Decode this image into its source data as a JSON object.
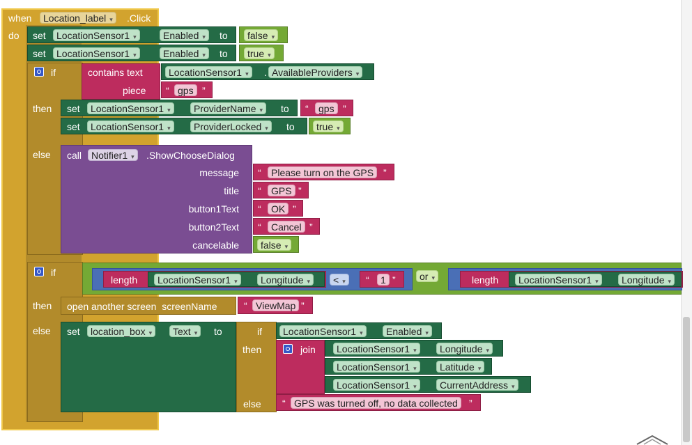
{
  "event": {
    "when": "when",
    "component": "Location_label",
    "event": ".Click",
    "do": "do"
  },
  "set1": {
    "set": "set",
    "comp": "LocationSensor1",
    "prop": "Enabled",
    "to": "to",
    "value": "false"
  },
  "set2": {
    "set": "set",
    "comp": "LocationSensor1",
    "prop": "Enabled",
    "to": "to",
    "value": "true"
  },
  "if1": {
    "if": "if",
    "contains": "contains text",
    "comp": "LocationSensor1",
    "prop": "AvailableProviders",
    "piece": "piece",
    "text": "gps",
    "then": "then",
    "else": "else"
  },
  "then1": {
    "set": "set",
    "comp": "LocationSensor1",
    "prop": "ProviderName",
    "to": "to",
    "value": "gps"
  },
  "then2": {
    "set": "set",
    "comp": "LocationSensor1",
    "prop": "ProviderLocked",
    "to": "to",
    "value": "true"
  },
  "call": {
    "call": "call",
    "comp": "Notifier1",
    "method": ".ShowChooseDialog",
    "args": [
      {
        "label": "message",
        "value": "Please turn on the GPS"
      },
      {
        "label": "title",
        "value": "GPS"
      },
      {
        "label": "button1Text",
        "value": "OK"
      },
      {
        "label": "button2Text",
        "value": "Cancel"
      }
    ],
    "cancel_label": "cancelable",
    "cancel_value": "false"
  },
  "if2": {
    "if": "if",
    "length": "length",
    "comp": "LocationSensor1",
    "prop": "Longitude",
    "op": "<",
    "num": "1",
    "or": "or",
    "length2": "length",
    "comp2": "LocationSensor1",
    "prop2": "Longitude",
    "then": "then",
    "else": "else"
  },
  "open": {
    "label": "open another screen  screenName",
    "value": "ViewMap"
  },
  "setbox": {
    "set": "set",
    "comp": "location_box",
    "prop": "Text",
    "to": "to"
  },
  "inlineif": {
    "if": "if",
    "comp": "LocationSensor1",
    "prop": "Enabled",
    "then": "then",
    "else": "else"
  },
  "join": {
    "label": "join",
    "rows": [
      {
        "comp": "LocationSensor1",
        "prop": "Longitude"
      },
      {
        "comp": "LocationSensor1",
        "prop": "Latitude"
      },
      {
        "comp": "LocationSensor1",
        "prop": "CurrentAddress"
      }
    ]
  },
  "elsemsg": "GPS was turned off, no data collected",
  "quote_open": "“",
  "quote_close": "”",
  "icons": {
    "mutator": "gear-icon",
    "dropdown": "chevron-down-icon"
  }
}
